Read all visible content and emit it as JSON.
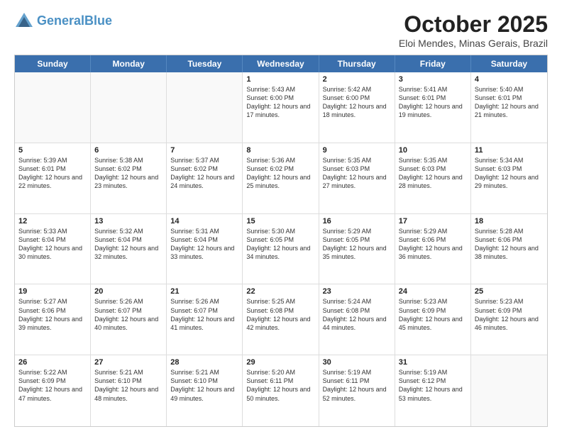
{
  "header": {
    "logo_line1": "General",
    "logo_line2": "Blue",
    "month": "October 2025",
    "location": "Eloi Mendes, Minas Gerais, Brazil"
  },
  "days_of_week": [
    "Sunday",
    "Monday",
    "Tuesday",
    "Wednesday",
    "Thursday",
    "Friday",
    "Saturday"
  ],
  "weeks": [
    [
      {
        "day": "",
        "text": ""
      },
      {
        "day": "",
        "text": ""
      },
      {
        "day": "",
        "text": ""
      },
      {
        "day": "1",
        "text": "Sunrise: 5:43 AM\nSunset: 6:00 PM\nDaylight: 12 hours and 17 minutes."
      },
      {
        "day": "2",
        "text": "Sunrise: 5:42 AM\nSunset: 6:00 PM\nDaylight: 12 hours and 18 minutes."
      },
      {
        "day": "3",
        "text": "Sunrise: 5:41 AM\nSunset: 6:01 PM\nDaylight: 12 hours and 19 minutes."
      },
      {
        "day": "4",
        "text": "Sunrise: 5:40 AM\nSunset: 6:01 PM\nDaylight: 12 hours and 21 minutes."
      }
    ],
    [
      {
        "day": "5",
        "text": "Sunrise: 5:39 AM\nSunset: 6:01 PM\nDaylight: 12 hours and 22 minutes."
      },
      {
        "day": "6",
        "text": "Sunrise: 5:38 AM\nSunset: 6:02 PM\nDaylight: 12 hours and 23 minutes."
      },
      {
        "day": "7",
        "text": "Sunrise: 5:37 AM\nSunset: 6:02 PM\nDaylight: 12 hours and 24 minutes."
      },
      {
        "day": "8",
        "text": "Sunrise: 5:36 AM\nSunset: 6:02 PM\nDaylight: 12 hours and 25 minutes."
      },
      {
        "day": "9",
        "text": "Sunrise: 5:35 AM\nSunset: 6:03 PM\nDaylight: 12 hours and 27 minutes."
      },
      {
        "day": "10",
        "text": "Sunrise: 5:35 AM\nSunset: 6:03 PM\nDaylight: 12 hours and 28 minutes."
      },
      {
        "day": "11",
        "text": "Sunrise: 5:34 AM\nSunset: 6:03 PM\nDaylight: 12 hours and 29 minutes."
      }
    ],
    [
      {
        "day": "12",
        "text": "Sunrise: 5:33 AM\nSunset: 6:04 PM\nDaylight: 12 hours and 30 minutes."
      },
      {
        "day": "13",
        "text": "Sunrise: 5:32 AM\nSunset: 6:04 PM\nDaylight: 12 hours and 32 minutes."
      },
      {
        "day": "14",
        "text": "Sunrise: 5:31 AM\nSunset: 6:04 PM\nDaylight: 12 hours and 33 minutes."
      },
      {
        "day": "15",
        "text": "Sunrise: 5:30 AM\nSunset: 6:05 PM\nDaylight: 12 hours and 34 minutes."
      },
      {
        "day": "16",
        "text": "Sunrise: 5:29 AM\nSunset: 6:05 PM\nDaylight: 12 hours and 35 minutes."
      },
      {
        "day": "17",
        "text": "Sunrise: 5:29 AM\nSunset: 6:06 PM\nDaylight: 12 hours and 36 minutes."
      },
      {
        "day": "18",
        "text": "Sunrise: 5:28 AM\nSunset: 6:06 PM\nDaylight: 12 hours and 38 minutes."
      }
    ],
    [
      {
        "day": "19",
        "text": "Sunrise: 5:27 AM\nSunset: 6:06 PM\nDaylight: 12 hours and 39 minutes."
      },
      {
        "day": "20",
        "text": "Sunrise: 5:26 AM\nSunset: 6:07 PM\nDaylight: 12 hours and 40 minutes."
      },
      {
        "day": "21",
        "text": "Sunrise: 5:26 AM\nSunset: 6:07 PM\nDaylight: 12 hours and 41 minutes."
      },
      {
        "day": "22",
        "text": "Sunrise: 5:25 AM\nSunset: 6:08 PM\nDaylight: 12 hours and 42 minutes."
      },
      {
        "day": "23",
        "text": "Sunrise: 5:24 AM\nSunset: 6:08 PM\nDaylight: 12 hours and 44 minutes."
      },
      {
        "day": "24",
        "text": "Sunrise: 5:23 AM\nSunset: 6:09 PM\nDaylight: 12 hours and 45 minutes."
      },
      {
        "day": "25",
        "text": "Sunrise: 5:23 AM\nSunset: 6:09 PM\nDaylight: 12 hours and 46 minutes."
      }
    ],
    [
      {
        "day": "26",
        "text": "Sunrise: 5:22 AM\nSunset: 6:09 PM\nDaylight: 12 hours and 47 minutes."
      },
      {
        "day": "27",
        "text": "Sunrise: 5:21 AM\nSunset: 6:10 PM\nDaylight: 12 hours and 48 minutes."
      },
      {
        "day": "28",
        "text": "Sunrise: 5:21 AM\nSunset: 6:10 PM\nDaylight: 12 hours and 49 minutes."
      },
      {
        "day": "29",
        "text": "Sunrise: 5:20 AM\nSunset: 6:11 PM\nDaylight: 12 hours and 50 minutes."
      },
      {
        "day": "30",
        "text": "Sunrise: 5:19 AM\nSunset: 6:11 PM\nDaylight: 12 hours and 52 minutes."
      },
      {
        "day": "31",
        "text": "Sunrise: 5:19 AM\nSunset: 6:12 PM\nDaylight: 12 hours and 53 minutes."
      },
      {
        "day": "",
        "text": ""
      }
    ]
  ]
}
